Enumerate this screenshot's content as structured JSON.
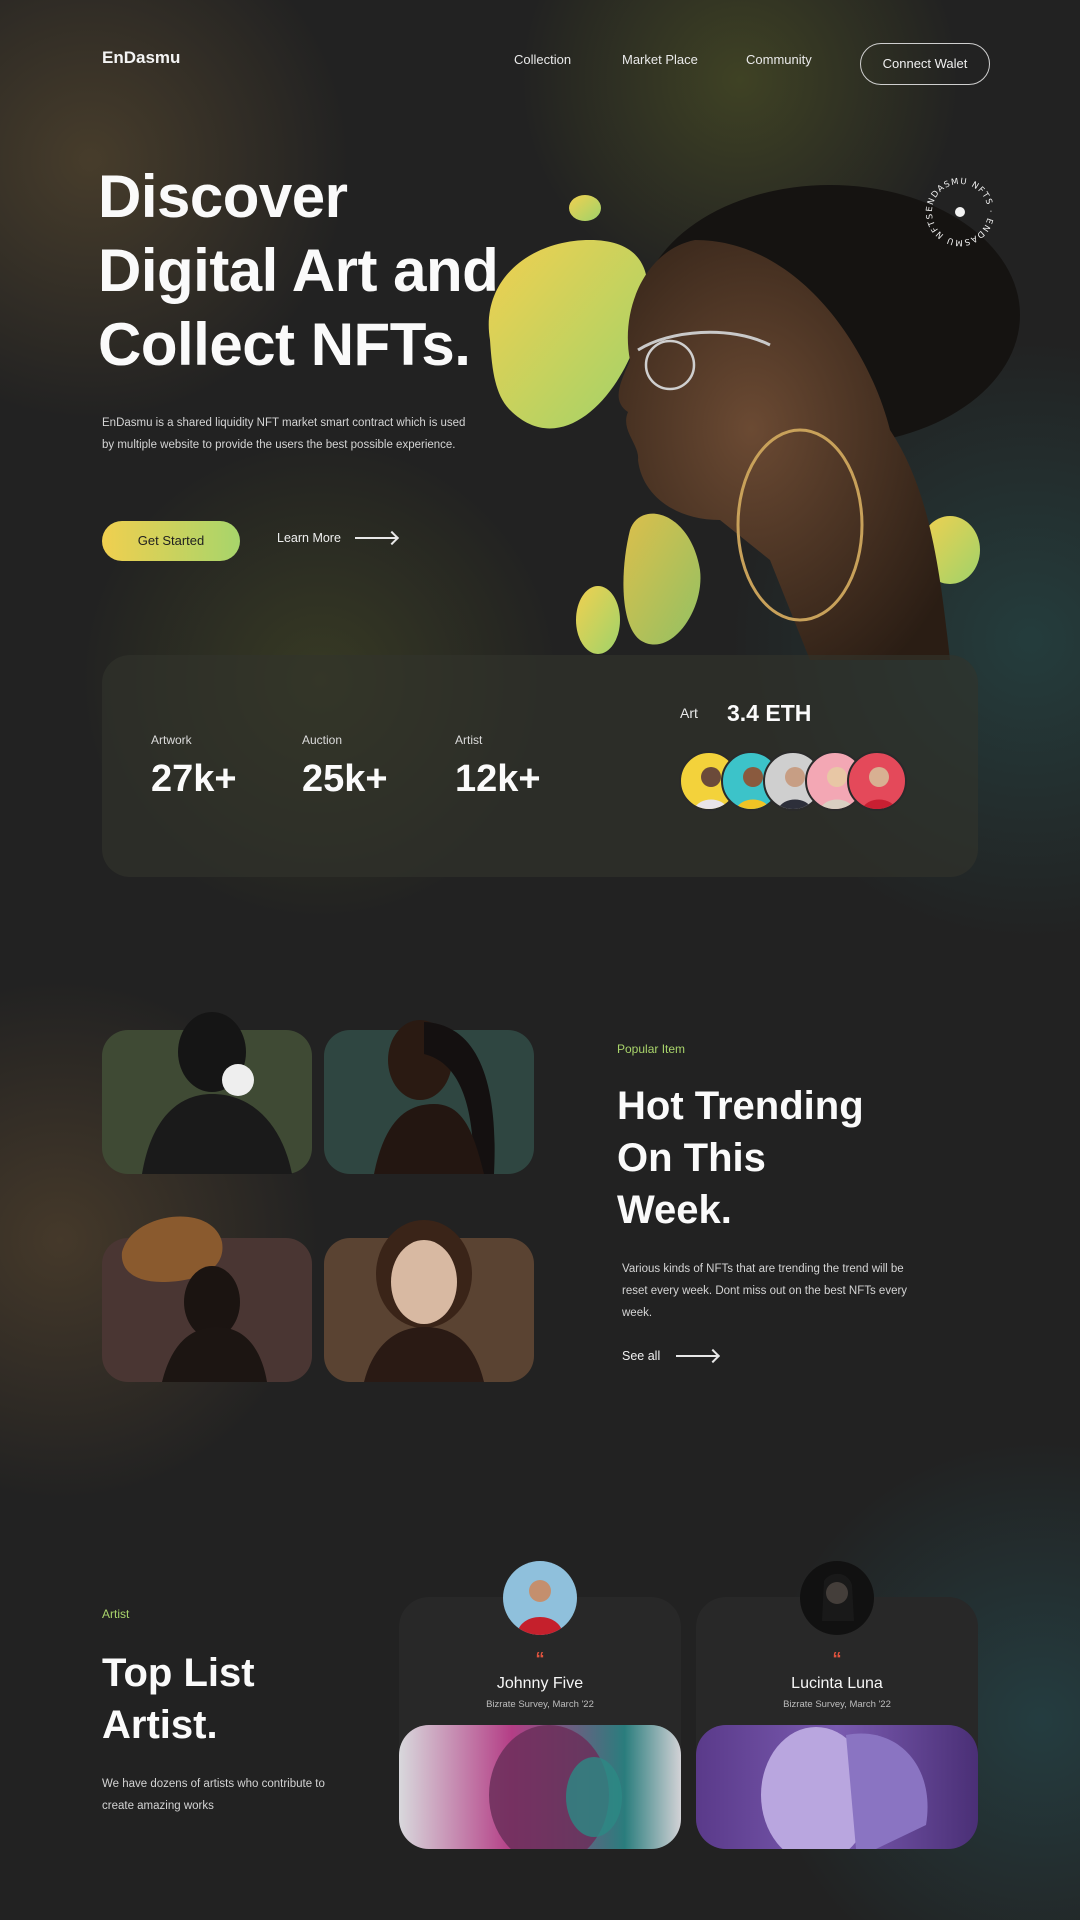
{
  "nav": {
    "logo": "EnDasmu",
    "links": [
      "Collection",
      "Market Place",
      "Community"
    ],
    "connect_label": "Connect Walet"
  },
  "hero": {
    "title_lines": [
      "Discover",
      "Digital Art and",
      "Collect NFTs."
    ],
    "description": "EnDasmu is a shared liquidity NFT market smart contract which is used by multiple website to provide the users the best possible experience.",
    "cta_primary": "Get Started",
    "cta_secondary": "Learn More",
    "badge_text": "ENDASMU NFTS · ENDASMU NFTS ·"
  },
  "stats": {
    "items": [
      {
        "label": "Artwork",
        "value": "27k+"
      },
      {
        "label": "Auction",
        "value": "25k+"
      },
      {
        "label": "Artist",
        "value": "12k+"
      }
    ],
    "art_label": "Art",
    "art_value": "3.4 ETH"
  },
  "trending": {
    "eyebrow": "Popular Item",
    "title_lines": [
      "Hot Trending",
      "On This",
      "Week."
    ],
    "description": "Various kinds of NFTs that are trending the trend will be reset every week. Dont miss out on the best NFTs every week.",
    "link": "See all"
  },
  "artists": {
    "eyebrow": "Artist",
    "title_lines": [
      "Top List",
      "Artist."
    ],
    "description": "We have dozens of artists who contribute to create amazing works",
    "cards": [
      {
        "quote": "“",
        "name": "Johnny Five",
        "subtitle": "Bizrate Survey, March '22"
      },
      {
        "quote": "“",
        "name": "Lucinta Luna",
        "subtitle": "Bizrate Survey, March '22"
      }
    ]
  },
  "colors": {
    "accent_yellow": "#f0cf4f",
    "accent_green": "#a9d46b",
    "quote_red": "#e0533e",
    "background": "#222222"
  }
}
